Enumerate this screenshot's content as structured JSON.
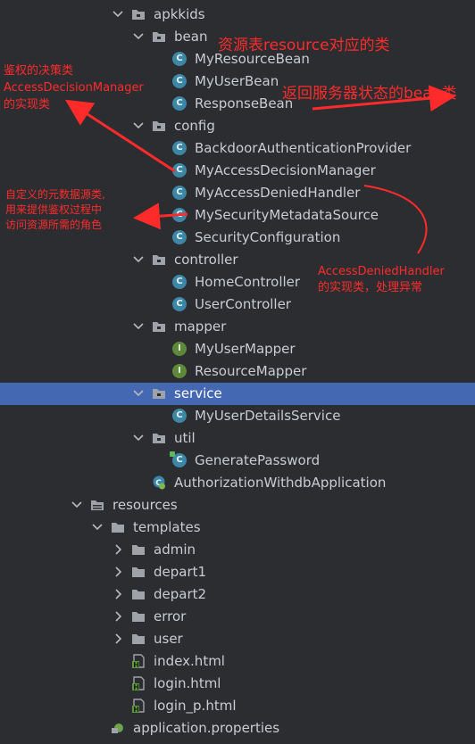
{
  "tree": {
    "items": [
      {
        "label": "apkkids",
        "kind": "package",
        "state": "open",
        "indent": 0
      },
      {
        "label": "bean",
        "kind": "package",
        "state": "open",
        "indent": 1
      },
      {
        "label": "MyResourceBean",
        "kind": "class",
        "state": "none",
        "indent": 2
      },
      {
        "label": "MyUserBean",
        "kind": "class",
        "state": "none",
        "indent": 2
      },
      {
        "label": "ResponseBean",
        "kind": "class",
        "state": "none",
        "indent": 2
      },
      {
        "label": "config",
        "kind": "package",
        "state": "open",
        "indent": 1
      },
      {
        "label": "BackdoorAuthenticationProvider",
        "kind": "class",
        "state": "none",
        "indent": 2
      },
      {
        "label": "MyAccessDecisionManager",
        "kind": "class",
        "state": "none",
        "indent": 2
      },
      {
        "label": "MyAccessDeniedHandler",
        "kind": "class",
        "state": "none",
        "indent": 2
      },
      {
        "label": "MySecurityMetadataSource",
        "kind": "class",
        "state": "none",
        "indent": 2
      },
      {
        "label": "SecurityConfiguration",
        "kind": "class",
        "state": "none",
        "indent": 2
      },
      {
        "label": "controller",
        "kind": "package",
        "state": "open",
        "indent": 1
      },
      {
        "label": "HomeController",
        "kind": "class",
        "state": "none",
        "indent": 2
      },
      {
        "label": "UserController",
        "kind": "class",
        "state": "none",
        "indent": 2
      },
      {
        "label": "mapper",
        "kind": "package",
        "state": "open",
        "indent": 1
      },
      {
        "label": "MyUserMapper",
        "kind": "interface",
        "state": "none",
        "indent": 2
      },
      {
        "label": "ResourceMapper",
        "kind": "interface",
        "state": "none",
        "indent": 2
      },
      {
        "label": "service",
        "kind": "package",
        "state": "open",
        "indent": 1,
        "selected": true
      },
      {
        "label": "MyUserDetailsService",
        "kind": "class",
        "state": "none",
        "indent": 2
      },
      {
        "label": "util",
        "kind": "package",
        "state": "open",
        "indent": 1
      },
      {
        "label": "GeneratePassword",
        "kind": "class-main",
        "state": "none",
        "indent": 2
      },
      {
        "label": "AuthorizationWithdbApplication",
        "kind": "app",
        "state": "none",
        "indent": 1
      },
      {
        "label": "resources",
        "kind": "resources",
        "state": "open",
        "indent": -2
      },
      {
        "label": "templates",
        "kind": "folder",
        "state": "open",
        "indent": -1
      },
      {
        "label": "admin",
        "kind": "folder",
        "state": "closed",
        "indent": 0
      },
      {
        "label": "depart1",
        "kind": "folder",
        "state": "closed",
        "indent": 0
      },
      {
        "label": "depart2",
        "kind": "folder",
        "state": "closed",
        "indent": 0
      },
      {
        "label": "error",
        "kind": "folder",
        "state": "closed",
        "indent": 0
      },
      {
        "label": "user",
        "kind": "folder",
        "state": "closed",
        "indent": 0
      },
      {
        "label": "index.html",
        "kind": "html",
        "state": "none",
        "indent": 0
      },
      {
        "label": "login.html",
        "kind": "html",
        "state": "none",
        "indent": 0
      },
      {
        "label": "login_p.html",
        "kind": "html",
        "state": "none",
        "indent": 0
      },
      {
        "label": "application.properties",
        "kind": "properties",
        "state": "none",
        "indent": -1
      }
    ]
  },
  "annotations": {
    "resource_bean": "资源表resource对应的类",
    "response_bean": "返回服务器状态的bean类",
    "decision_line1": "鉴权的决策类",
    "decision_line2": "AccessDecisionManager",
    "decision_line3": "的实现类",
    "metadata_line1": "自定义的元数据源类,",
    "metadata_line2": "用来提供鉴权过程中",
    "metadata_line3": "访问资源所需的角色",
    "denied_line1": "AccessDeniedHandler",
    "denied_line2": "的实现类，处理异常"
  },
  "colors": {
    "background": "#2b2d30",
    "selection": "#4468b1",
    "text": "#c9ccd2",
    "annotation": "#ff2b2b",
    "class_icon": "#3d87a6",
    "interface_icon": "#5d8a3a"
  },
  "icons": {
    "package": "package-folder-icon",
    "class": "class-icon",
    "interface": "interface-icon",
    "folder": "folder-icon",
    "html": "html-file-icon",
    "properties": "properties-file-icon"
  }
}
